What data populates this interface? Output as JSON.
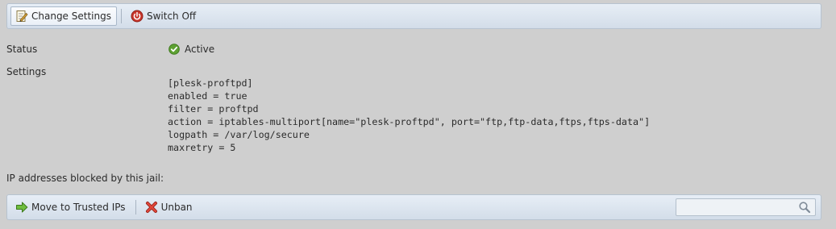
{
  "top_toolbar": {
    "change_settings_label": "Change Settings",
    "switch_off_label": "Switch Off"
  },
  "status": {
    "label": "Status",
    "value": "Active"
  },
  "settings": {
    "label": "Settings",
    "config": "[plesk-proftpd]\nenabled = true\nfilter = proftpd\naction = iptables-multiport[name=\"plesk-proftpd\", port=\"ftp,ftp-data,ftps,ftps-data\"]\nlogpath = /var/log/secure\nmaxretry = 5"
  },
  "blocked_ips": {
    "label": "IP addresses blocked by this jail:"
  },
  "bottom_toolbar": {
    "move_to_trusted_label": "Move to Trusted IPs",
    "unban_label": "Unban",
    "search_placeholder": ""
  },
  "colors": {
    "active_green": "#5da132",
    "switch_off_red": "#c8362b",
    "arrow_green": "#5aa832",
    "unban_red": "#d23a2c"
  }
}
